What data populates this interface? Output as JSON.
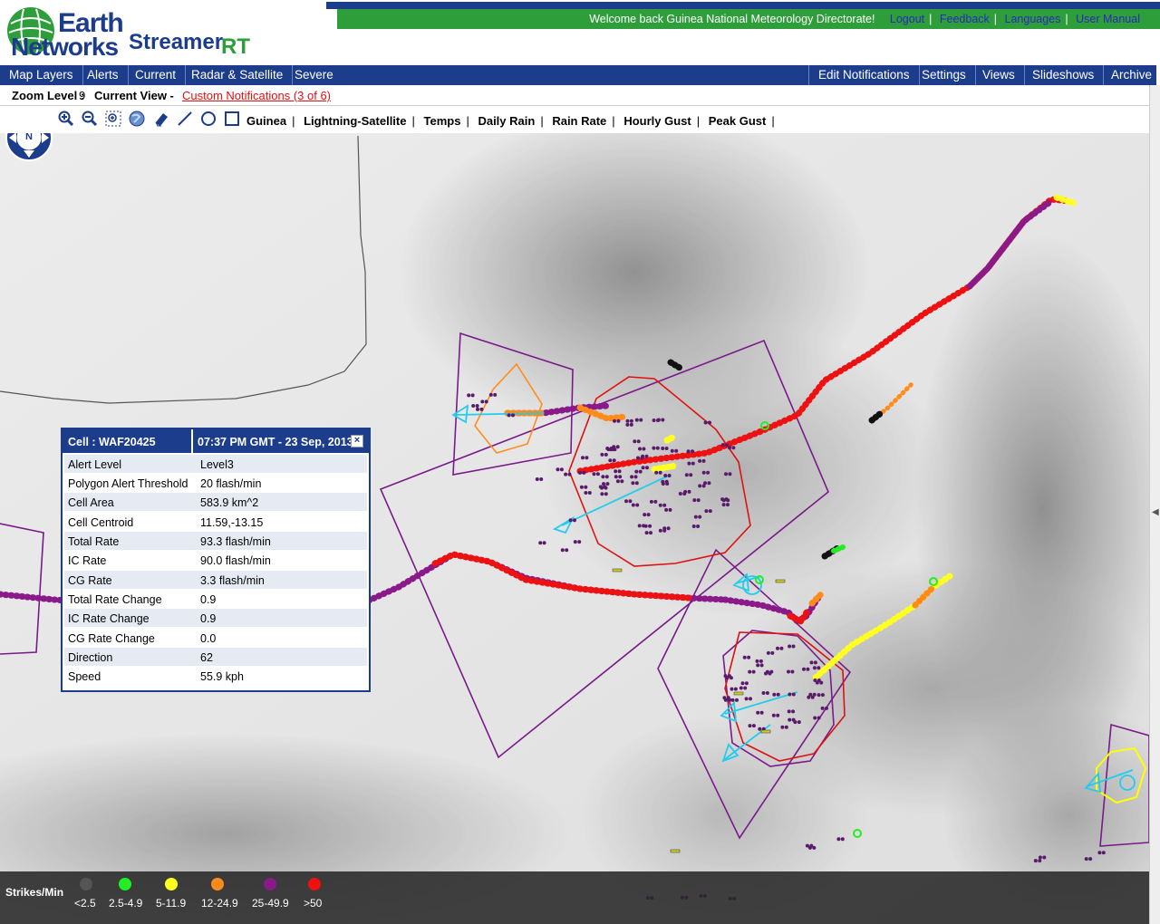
{
  "header": {
    "brand_line1": "Earth",
    "brand_line2": "Networks",
    "product": "Streamer",
    "product_suffix": "RT",
    "welcome": "Welcome back  Guinea National Meteorology Directorate!",
    "links": [
      "Logout",
      "Feedback",
      "Languages",
      "User Manual"
    ]
  },
  "nav": {
    "left": [
      "Map Layers",
      "Alerts",
      "Current",
      "Radar & Satellite",
      "Severe"
    ],
    "right": [
      "Edit Notifications",
      "Settings",
      "Views",
      "Slideshows",
      "Archive"
    ]
  },
  "status": {
    "zoom_label": "Zoom Level :",
    "zoom_value": "9",
    "view_label": "Current View -",
    "custom_notifications": "Custom Notifications (3 of 6)"
  },
  "toolbar": {
    "tools": [
      "zoom-in-icon",
      "zoom-out-icon",
      "zoom-box-icon",
      "globe-icon",
      "eraser-icon",
      "line-icon",
      "circle-icon",
      "rectangle-icon"
    ],
    "layers": [
      "Guinea",
      "Lightning-Satellite",
      "Temps",
      "Daily Rain",
      "Rain Rate",
      "Hourly Gust",
      "Peak Gust"
    ]
  },
  "compass": {
    "north": "N"
  },
  "popup": {
    "cell_label": "Cell :  WAF20425",
    "time": "07:37 PM GMT - 23 Sep, 2013",
    "close": "×",
    "rows": [
      {
        "label": "Alert Level",
        "value": "Level3"
      },
      {
        "label": "Polygon Alert Threshold",
        "value": "20  flash/min"
      },
      {
        "label": "Cell Area",
        "value": "583.9  km^2"
      },
      {
        "label": "Cell Centroid",
        "value": "11.59,-13.15"
      },
      {
        "label": "Total Rate",
        "value": "93.3  flash/min"
      },
      {
        "label": "IC Rate",
        "value": "90.0  flash/min"
      },
      {
        "label": "CG Rate",
        "value": "3.3  flash/min"
      },
      {
        "label": "Total Rate Change",
        "value": "0.9"
      },
      {
        "label": "IC Rate Change",
        "value": "0.9"
      },
      {
        "label": "CG Rate Change",
        "value": "0.0"
      },
      {
        "label": "Direction",
        "value": "62"
      },
      {
        "label": "Speed",
        "value": "55.9 kph"
      }
    ]
  },
  "legend": {
    "title": "Strikes/Min",
    "items": [
      {
        "label": "<2.5",
        "color": "#555555"
      },
      {
        "label": "2.5-4.9",
        "color": "#22ee22"
      },
      {
        "label": "5-11.9",
        "color": "#ffff22"
      },
      {
        "label": "12-24.9",
        "color": "#ff8c1a"
      },
      {
        "label": "25-49.9",
        "color": "#8a1a8a"
      },
      {
        "label": ">50",
        "color": "#ee1111"
      }
    ]
  },
  "colors": {
    "nav_blue": "#1c3c8c",
    "header_green": "#2e9e3a",
    "track_red": "#ee1111",
    "track_purple": "#8a1a8a",
    "alert_polygon": "#7a1a8a",
    "cell_red": "#dd1111",
    "direction_cyan": "#22ccee"
  }
}
